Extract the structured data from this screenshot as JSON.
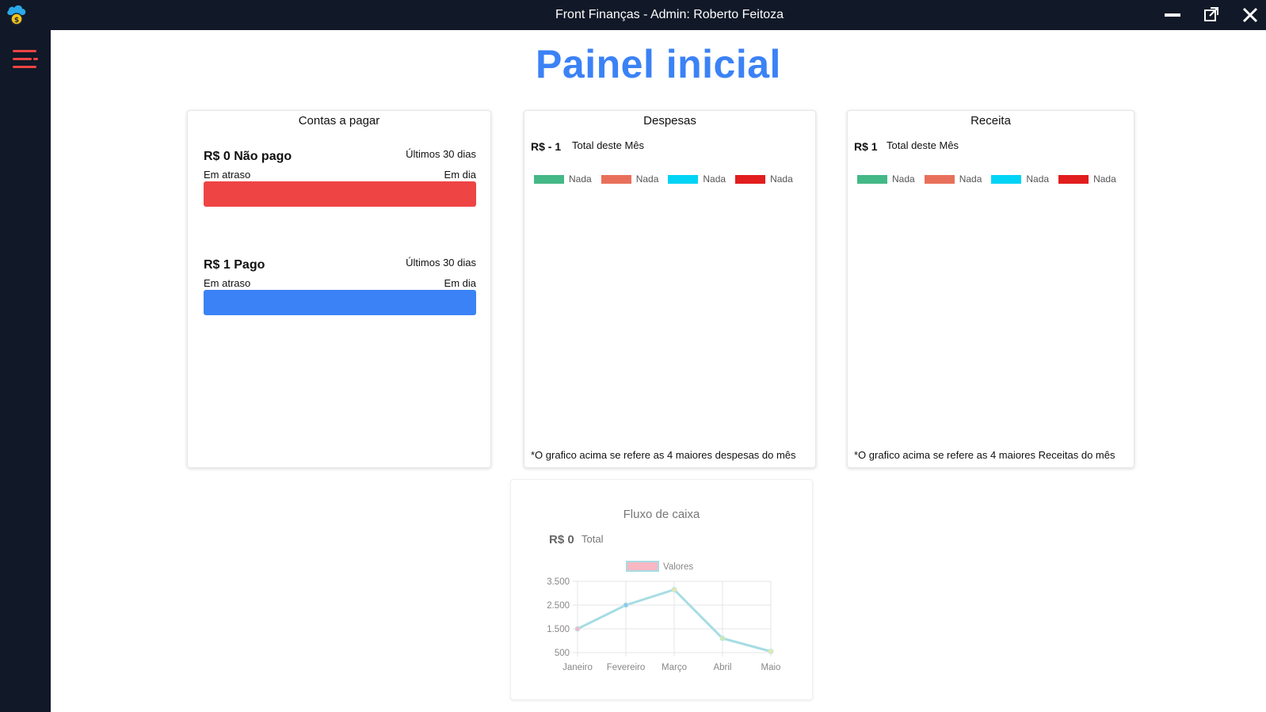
{
  "window": {
    "title": "Front Finanças - Admin: Roberto Feitoza"
  },
  "icons": {
    "logo": "cloud-coin-logo-icon",
    "menu": "hamburger-menu-icon",
    "minimize": "minimize-icon",
    "popout": "external-window-icon",
    "close": "close-icon"
  },
  "page": {
    "title": "Painel inicial"
  },
  "contas": {
    "title": "Contas a pagar",
    "blocks": [
      {
        "amount": "R$ 0 Não pago",
        "period": "Últimos 30 dias",
        "left": "Em atraso",
        "right": "Em dia",
        "color": "#ef4444",
        "fill": 1.0
      },
      {
        "amount": "R$ 1 Pago",
        "period": "Últimos 30 dias",
        "left": "Em atraso",
        "right": "Em dia",
        "color": "#3b82f6",
        "fill": 1.0
      }
    ]
  },
  "despesas": {
    "title": "Despesas",
    "value": "R$ - 1",
    "label": "Total deste Mês",
    "legend": [
      {
        "label": "Nada",
        "color": "#44b887"
      },
      {
        "label": "Nada",
        "color": "#e8705a"
      },
      {
        "label": "Nada",
        "color": "#00d4f5"
      },
      {
        "label": "Nada",
        "color": "#e11d1d"
      }
    ],
    "note": "*O grafico acima se refere as 4 maiores despesas do mês"
  },
  "receita": {
    "title": "Receita",
    "value": "R$ 1",
    "label": "Total deste Mês",
    "legend": [
      {
        "label": "Nada",
        "color": "#44b887"
      },
      {
        "label": "Nada",
        "color": "#e8705a"
      },
      {
        "label": "Nada",
        "color": "#00d4f5"
      },
      {
        "label": "Nada",
        "color": "#e11d1d"
      }
    ],
    "note": "*O grafico acima se refere as 4 maiores Receitas do mês"
  },
  "fluxo": {
    "title": "Fluxo de caixa",
    "value": "R$ 0",
    "label": "Total"
  },
  "chart_data": {
    "type": "line",
    "title": "",
    "categories": [
      "Janeiro",
      "Fevereiro",
      "Março",
      "Abril",
      "Maio"
    ],
    "series": [
      {
        "name": "Valores",
        "values": [
          1500,
          2500,
          3150,
          1100,
          550
        ],
        "line_color": "#a6dde3",
        "legend_fill": "#f7b7c3",
        "point_colors": [
          "#f4b6c4",
          "#8fc7e8",
          "#e6e6a3",
          "#cfe8a6",
          "#e6eaa0"
        ]
      }
    ],
    "y_ticks": [
      "3.500",
      "2.500",
      "1.500",
      "500"
    ],
    "ylim": [
      500,
      3500
    ],
    "grid": true,
    "legend_position": "top"
  }
}
